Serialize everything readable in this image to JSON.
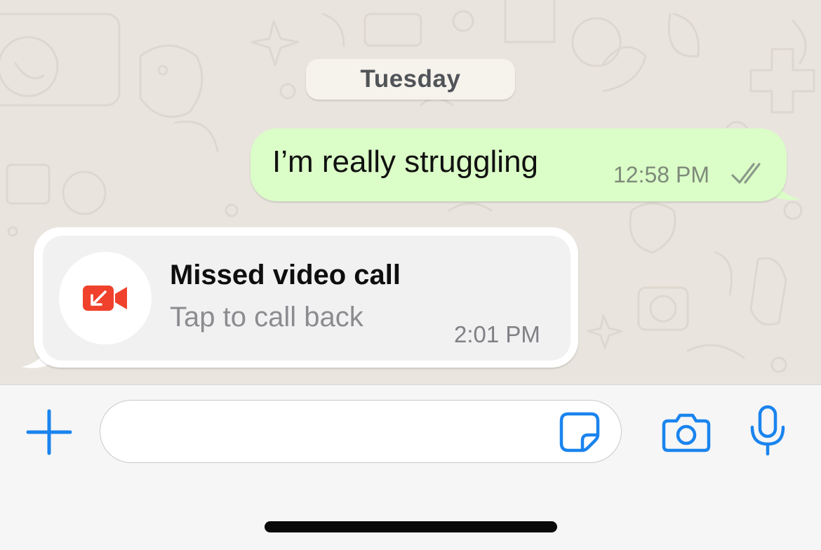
{
  "chat": {
    "date_separator": "Tuesday",
    "outgoing_message": {
      "text": "I’m really struggling",
      "time": "12:58 PM",
      "status": "read"
    },
    "missed_call": {
      "title": "Missed video call",
      "subtitle": "Tap to call back",
      "time": "2:01 PM",
      "icon": "missed-video-call-icon"
    }
  },
  "composer": {
    "input_value": "",
    "icons": [
      "plus-icon",
      "sticker-icon",
      "camera-icon",
      "microphone-icon"
    ]
  },
  "colors": {
    "wallpaper": "#e9e5de",
    "outgoing_bubble": "#dbfdc7",
    "accent_blue": "#1a84ee",
    "missed_call_red": "#f0412c",
    "read_ticks": "#8a9a8a"
  }
}
